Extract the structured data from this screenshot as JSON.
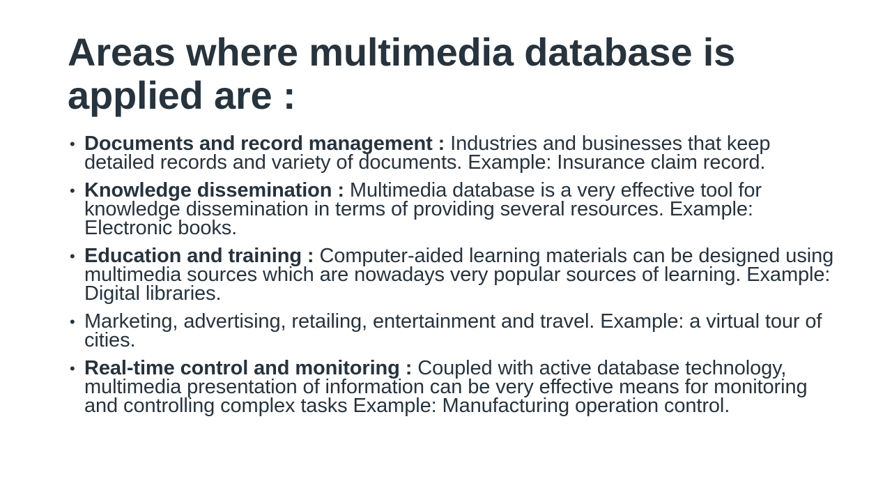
{
  "slide": {
    "title": "Areas where multimedia database is applied are :",
    "bullets": [
      {
        "term": "Documents and record management :",
        "text": " Industries and businesses that keep detailed records and variety of documents. Example: Insurance claim record."
      },
      {
        "term": "Knowledge dissemination :",
        "text": " Multimedia database is a very effective tool for knowledge dissemination in terms of providing several resources. Example: Electronic books."
      },
      {
        "term": "Education and training :",
        "text": " Computer-aided learning materials can be designed using multimedia sources which are nowadays very popular sources of learning. Example: Digital libraries."
      },
      {
        "term": "",
        "text": "Marketing, advertising, retailing, entertainment and travel. Example: a virtual tour of cities."
      },
      {
        "term": "Real-time control and monitoring :",
        "text": " Coupled with active database technology, multimedia presentation of information can be very effective means for monitoring and controlling complex tasks Example: Manufacturing operation control."
      }
    ],
    "bullet_glyph": "•"
  }
}
